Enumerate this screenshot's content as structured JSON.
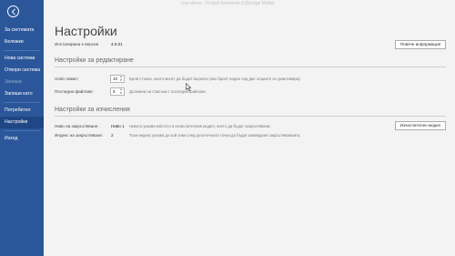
{
  "window": {
    "title": "Live demo - Project Elements 6 [Design Mode]"
  },
  "sidebar": {
    "items": [
      {
        "label": "За системата",
        "state": "normal"
      },
      {
        "label": "Бележки",
        "state": "normal"
      },
      {
        "label": "Нова система",
        "state": "normal"
      },
      {
        "label": "Отвори система",
        "state": "normal"
      },
      {
        "label": "Запиши",
        "state": "disabled"
      },
      {
        "label": "Запиши като",
        "state": "normal"
      },
      {
        "label": "Потребител",
        "state": "normal"
      },
      {
        "label": "Настройки",
        "state": "active"
      },
      {
        "label": "Изход",
        "state": "normal"
      }
    ]
  },
  "main": {
    "title": "Настройки",
    "installed_label": "Инсталирана е версия",
    "installed_value": "4.5.01",
    "more_info_button": "Повече информация",
    "editing": {
      "heading": "Настройки за редактиране",
      "undo_label": "Undo лимит:",
      "undo_value": "10",
      "undo_desc": "Брой стъпки, които могат да бъдат върнати (ако броят падне под две опциите се деактивира).",
      "recent_label": "Последни файлове:",
      "recent_value": "5",
      "recent_desc": "Дължина на списъка с последни файлове."
    },
    "calc": {
      "heading": "Настройки за изчисления",
      "round_label": "Ниво на закръгляване:",
      "round_value": "Ниво 1",
      "round_desc": "Нивото указва мястото в изчислителния модел, което да бъдат закръглявани.",
      "index_label": "Индекс на закръгляване:",
      "index_value": "2",
      "index_desc": "Този индекс указва до кой знак след десетичната точка да бъдат извеждани закръгляванията.",
      "model_button": "Изчислителен модел"
    }
  }
}
